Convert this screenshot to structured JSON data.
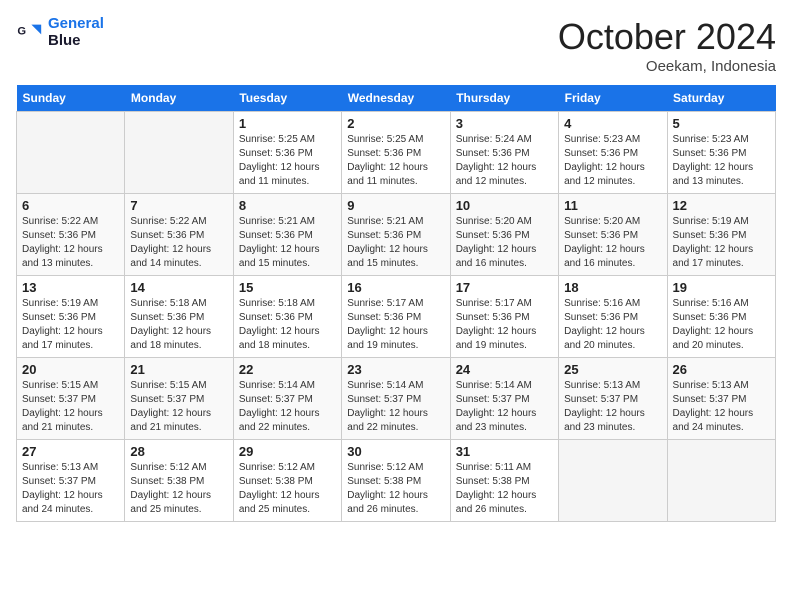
{
  "header": {
    "logo_line1": "General",
    "logo_line2": "Blue",
    "month": "October 2024",
    "location": "Oeekam, Indonesia"
  },
  "weekdays": [
    "Sunday",
    "Monday",
    "Tuesday",
    "Wednesday",
    "Thursday",
    "Friday",
    "Saturday"
  ],
  "weeks": [
    [
      {
        "day": "",
        "info": ""
      },
      {
        "day": "",
        "info": ""
      },
      {
        "day": "1",
        "info": "Sunrise: 5:25 AM\nSunset: 5:36 PM\nDaylight: 12 hours and 11 minutes."
      },
      {
        "day": "2",
        "info": "Sunrise: 5:25 AM\nSunset: 5:36 PM\nDaylight: 12 hours and 11 minutes."
      },
      {
        "day": "3",
        "info": "Sunrise: 5:24 AM\nSunset: 5:36 PM\nDaylight: 12 hours and 12 minutes."
      },
      {
        "day": "4",
        "info": "Sunrise: 5:23 AM\nSunset: 5:36 PM\nDaylight: 12 hours and 12 minutes."
      },
      {
        "day": "5",
        "info": "Sunrise: 5:23 AM\nSunset: 5:36 PM\nDaylight: 12 hours and 13 minutes."
      }
    ],
    [
      {
        "day": "6",
        "info": "Sunrise: 5:22 AM\nSunset: 5:36 PM\nDaylight: 12 hours and 13 minutes."
      },
      {
        "day": "7",
        "info": "Sunrise: 5:22 AM\nSunset: 5:36 PM\nDaylight: 12 hours and 14 minutes."
      },
      {
        "day": "8",
        "info": "Sunrise: 5:21 AM\nSunset: 5:36 PM\nDaylight: 12 hours and 15 minutes."
      },
      {
        "day": "9",
        "info": "Sunrise: 5:21 AM\nSunset: 5:36 PM\nDaylight: 12 hours and 15 minutes."
      },
      {
        "day": "10",
        "info": "Sunrise: 5:20 AM\nSunset: 5:36 PM\nDaylight: 12 hours and 16 minutes."
      },
      {
        "day": "11",
        "info": "Sunrise: 5:20 AM\nSunset: 5:36 PM\nDaylight: 12 hours and 16 minutes."
      },
      {
        "day": "12",
        "info": "Sunrise: 5:19 AM\nSunset: 5:36 PM\nDaylight: 12 hours and 17 minutes."
      }
    ],
    [
      {
        "day": "13",
        "info": "Sunrise: 5:19 AM\nSunset: 5:36 PM\nDaylight: 12 hours and 17 minutes."
      },
      {
        "day": "14",
        "info": "Sunrise: 5:18 AM\nSunset: 5:36 PM\nDaylight: 12 hours and 18 minutes."
      },
      {
        "day": "15",
        "info": "Sunrise: 5:18 AM\nSunset: 5:36 PM\nDaylight: 12 hours and 18 minutes."
      },
      {
        "day": "16",
        "info": "Sunrise: 5:17 AM\nSunset: 5:36 PM\nDaylight: 12 hours and 19 minutes."
      },
      {
        "day": "17",
        "info": "Sunrise: 5:17 AM\nSunset: 5:36 PM\nDaylight: 12 hours and 19 minutes."
      },
      {
        "day": "18",
        "info": "Sunrise: 5:16 AM\nSunset: 5:36 PM\nDaylight: 12 hours and 20 minutes."
      },
      {
        "day": "19",
        "info": "Sunrise: 5:16 AM\nSunset: 5:36 PM\nDaylight: 12 hours and 20 minutes."
      }
    ],
    [
      {
        "day": "20",
        "info": "Sunrise: 5:15 AM\nSunset: 5:37 PM\nDaylight: 12 hours and 21 minutes."
      },
      {
        "day": "21",
        "info": "Sunrise: 5:15 AM\nSunset: 5:37 PM\nDaylight: 12 hours and 21 minutes."
      },
      {
        "day": "22",
        "info": "Sunrise: 5:14 AM\nSunset: 5:37 PM\nDaylight: 12 hours and 22 minutes."
      },
      {
        "day": "23",
        "info": "Sunrise: 5:14 AM\nSunset: 5:37 PM\nDaylight: 12 hours and 22 minutes."
      },
      {
        "day": "24",
        "info": "Sunrise: 5:14 AM\nSunset: 5:37 PM\nDaylight: 12 hours and 23 minutes."
      },
      {
        "day": "25",
        "info": "Sunrise: 5:13 AM\nSunset: 5:37 PM\nDaylight: 12 hours and 23 minutes."
      },
      {
        "day": "26",
        "info": "Sunrise: 5:13 AM\nSunset: 5:37 PM\nDaylight: 12 hours and 24 minutes."
      }
    ],
    [
      {
        "day": "27",
        "info": "Sunrise: 5:13 AM\nSunset: 5:37 PM\nDaylight: 12 hours and 24 minutes."
      },
      {
        "day": "28",
        "info": "Sunrise: 5:12 AM\nSunset: 5:38 PM\nDaylight: 12 hours and 25 minutes."
      },
      {
        "day": "29",
        "info": "Sunrise: 5:12 AM\nSunset: 5:38 PM\nDaylight: 12 hours and 25 minutes."
      },
      {
        "day": "30",
        "info": "Sunrise: 5:12 AM\nSunset: 5:38 PM\nDaylight: 12 hours and 26 minutes."
      },
      {
        "day": "31",
        "info": "Sunrise: 5:11 AM\nSunset: 5:38 PM\nDaylight: 12 hours and 26 minutes."
      },
      {
        "day": "",
        "info": ""
      },
      {
        "day": "",
        "info": ""
      }
    ]
  ]
}
